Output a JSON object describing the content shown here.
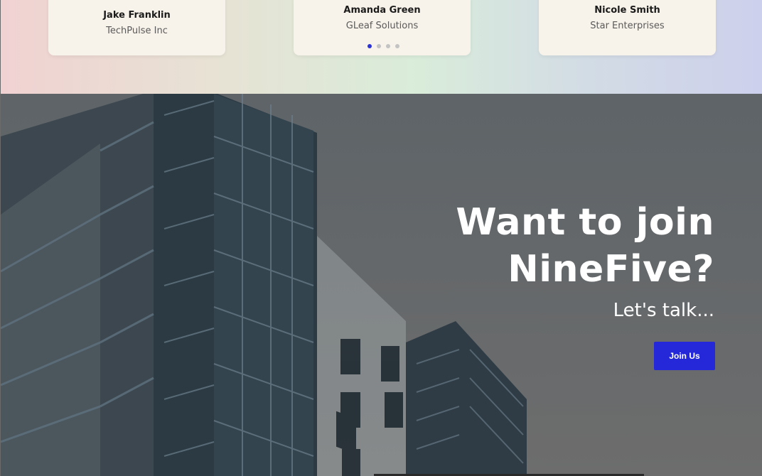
{
  "testimonials": {
    "cards": [
      {
        "name": "Jake Franklin",
        "company": "TechPulse Inc"
      },
      {
        "name": "Amanda Green",
        "company": "GLeaf Solutions"
      },
      {
        "name": "Nicole Smith",
        "company": "Star Enterprises"
      }
    ],
    "carousel": {
      "pages": 4,
      "active_index": 0,
      "active_color": "#2b32d6",
      "inactive_color": "#c3c3c3"
    }
  },
  "hero": {
    "title_line1": "Want to join",
    "title_line2": "NineFive?",
    "subtitle": "Let's talk...",
    "cta_label": "Join Us"
  },
  "colors": {
    "accent": "#2528d8",
    "overlay": "#666a6d"
  }
}
